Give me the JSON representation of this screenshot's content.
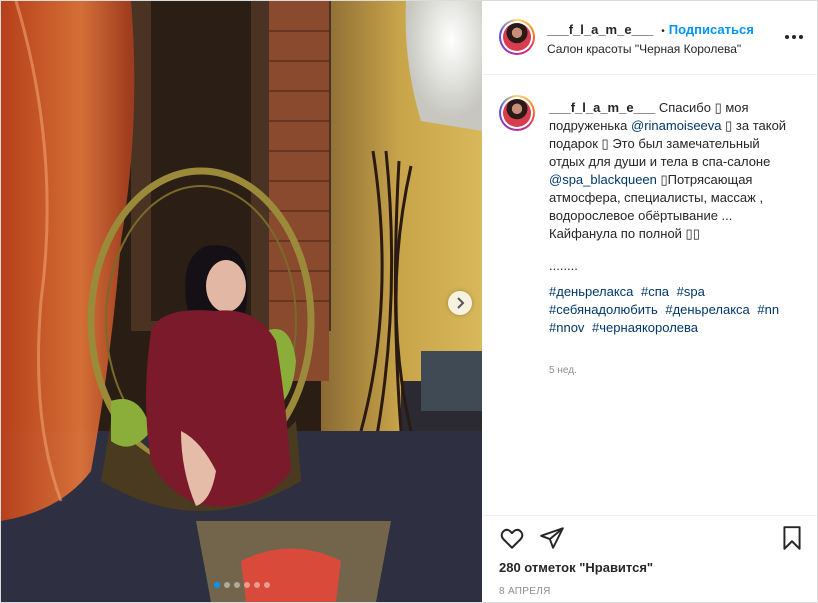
{
  "post": {
    "username": "___f_l_a_m_e___",
    "follow_label": "Подписаться",
    "separator": "•",
    "location": "Салон красоты \"Черная Королева\""
  },
  "caption": {
    "username": "___f_l_a_m_e___",
    "text1": " Спасибо ▯ моя подруженька ",
    "mention1": "@rinamoiseeva",
    "text2": " ▯ за такой подарок ▯ Это был замечательный отдых для души и тела в спа-салоне ",
    "mention2": "@spa_blackqueen",
    "text3": " ▯Потрясающая атмосфера, специалисты, массаж , водорослевое обёртывание ... Кайфанула по полной ▯▯",
    "dots_line": "........",
    "hashtags": [
      "#деньрелакса",
      "#спа",
      "#spa",
      "#себянадолюбить",
      "#деньрелакса",
      "#nn",
      "#nnov",
      "#чернаякоролева"
    ],
    "time_ago": "5 нед."
  },
  "actions": {
    "likes_text": "280 отметок \"Нравится\"",
    "date_text": "8 АПРЕЛЯ"
  },
  "carousel": {
    "count": 6,
    "active": 0
  },
  "colors": {
    "link": "#0095f6",
    "mention": "#00376b",
    "muted": "#8e8e8e",
    "text": "#262626"
  },
  "icons": [
    "more-options-icon",
    "heart-icon",
    "share-icon",
    "bookmark-icon",
    "chevron-right-icon"
  ]
}
